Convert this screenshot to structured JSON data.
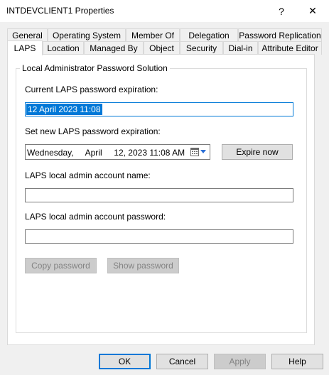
{
  "window": {
    "title": "INTDEVCLIENT1 Properties",
    "help_glyph": "?",
    "close_glyph": "✕"
  },
  "tabs_row1": [
    "General",
    "Operating System",
    "Member Of",
    "Delegation",
    "Password Replication"
  ],
  "tabs_row2": [
    "LAPS",
    "Location",
    "Managed By",
    "Object",
    "Security",
    "Dial-in",
    "Attribute Editor"
  ],
  "active_tab": "LAPS",
  "group": {
    "title": "Local Administrator Password Solution",
    "current_expiration_label": "Current LAPS password expiration:",
    "current_expiration_value": "12 April 2023 11:08",
    "new_expiration_label": "Set new LAPS password expiration:",
    "new_expiration_value": "Wednesday,     April     12, 2023 11:08 AM",
    "expire_now_label": "Expire now",
    "account_name_label": "LAPS local admin account name:",
    "account_name_value": "",
    "account_password_label": "LAPS local admin account password:",
    "account_password_value": "",
    "copy_password_label": "Copy password",
    "show_password_label": "Show password"
  },
  "footer": {
    "ok": "OK",
    "cancel": "Cancel",
    "apply": "Apply",
    "help": "Help"
  },
  "colors": {
    "accent": "#0078d7",
    "window_bg": "#f0f0f0",
    "panel_bg": "#ffffff"
  }
}
